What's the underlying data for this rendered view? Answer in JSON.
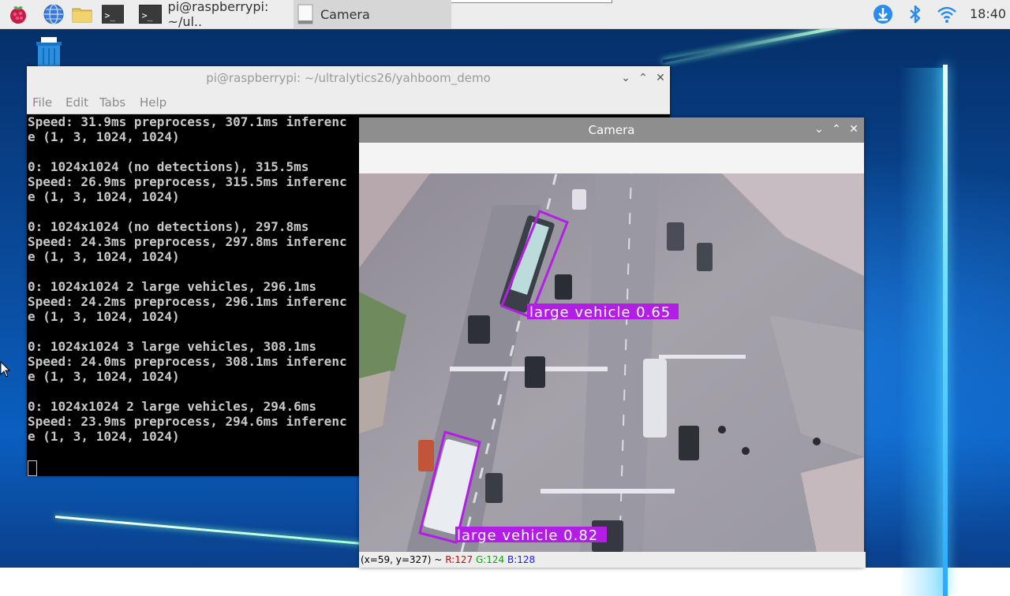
{
  "taskbar": {
    "tasks": [
      {
        "label": "pi@raspberrypi: ~/ul.."
      },
      {
        "label": "Camera"
      }
    ],
    "clock": "18:40",
    "icons": [
      "raspberry-menu-icon",
      "web-browser-icon",
      "file-manager-icon",
      "terminal-icon",
      "download-icon",
      "bluetooth-icon",
      "wifi-icon"
    ]
  },
  "terminal": {
    "title": "pi@raspberrypi: ~/ultralytics26/yahboom_demo",
    "menu": [
      "File",
      "Edit",
      "Tabs",
      "Help"
    ],
    "lines": [
      "Speed: 31.9ms preprocess, 307.1ms inferenc",
      "e (1, 3, 1024, 1024)",
      "",
      "0: 1024x1024 (no detections), 315.5ms",
      "Speed: 26.9ms preprocess, 315.5ms inferenc",
      "e (1, 3, 1024, 1024)",
      "",
      "0: 1024x1024 (no detections), 297.8ms",
      "Speed: 24.3ms preprocess, 297.8ms inferenc",
      "e (1, 3, 1024, 1024)",
      "",
      "0: 1024x1024 2 large vehicles, 296.1ms",
      "Speed: 24.2ms preprocess, 296.1ms inferenc",
      "e (1, 3, 1024, 1024)",
      "",
      "0: 1024x1024 3 large vehicles, 308.1ms",
      "Speed: 24.0ms preprocess, 308.1ms inferenc",
      "e (1, 3, 1024, 1024)",
      "",
      "0: 1024x1024 2 large vehicles, 294.6ms",
      "Speed: 23.9ms preprocess, 294.6ms inferenc",
      "e (1, 3, 1024, 1024)"
    ]
  },
  "camera": {
    "title": "Camera",
    "detections": [
      {
        "label": "large vehicle 0.65"
      },
      {
        "label": "large vehicle 0.82"
      }
    ],
    "status": {
      "coords": "(x=59, y=327) ~",
      "r": "R:127",
      "g": "G:124",
      "b": "B:128"
    },
    "box_color": "#b21ee6"
  }
}
